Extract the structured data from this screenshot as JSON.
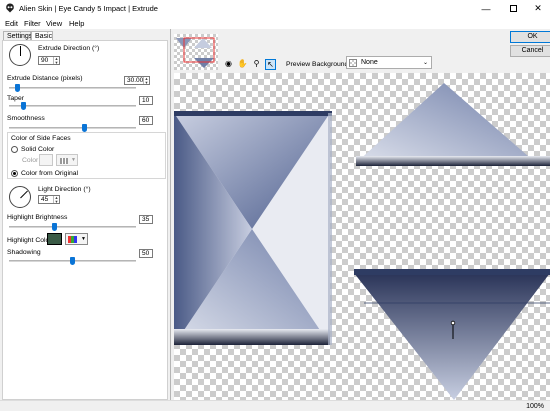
{
  "window": {
    "title": "Alien Skin | Eye Candy 5 Impact | Extrude"
  },
  "menu": [
    "Edit",
    "Filter",
    "View",
    "Help"
  ],
  "tabs": [
    {
      "label": "Settings"
    },
    {
      "label": "Basic"
    }
  ],
  "controls": {
    "extrude_direction": {
      "label": "Extrude Direction (°)",
      "value": "90"
    },
    "extrude_distance": {
      "label": "Extrude Distance (pixels)",
      "value": "30.00",
      "slider_fraction": 0.05
    },
    "taper": {
      "label": "Taper",
      "value": "10",
      "slider_fraction": 0.1
    },
    "smoothness": {
      "label": "Smoothness",
      "value": "60",
      "slider_fraction": 0.6
    },
    "side_faces": {
      "group_label": "Color of Side Faces",
      "solid_label": "Solid Color",
      "color_label": "Color",
      "original_label": "Color from Original",
      "selected": "original"
    },
    "light_direction": {
      "label": "Light Direction (°)",
      "value": "45"
    },
    "highlight_brightness": {
      "label": "Highlight Brightness",
      "value": "35",
      "slider_fraction": 0.35
    },
    "highlight_color": {
      "label": "Highlight Color",
      "swatch": "#3a5a46"
    },
    "shadowing": {
      "label": "Shadowing",
      "value": "50",
      "slider_fraction": 0.5
    }
  },
  "preview": {
    "background_label": "Preview Background:",
    "background_value": "None"
  },
  "buttons": {
    "ok": "OK",
    "cancel": "Cancel"
  },
  "status": {
    "zoom": "100%"
  },
  "colors": {
    "accent": "#0a74d6",
    "shape_dark": "#2e3c63",
    "shape_light": "#c5ccdf"
  }
}
